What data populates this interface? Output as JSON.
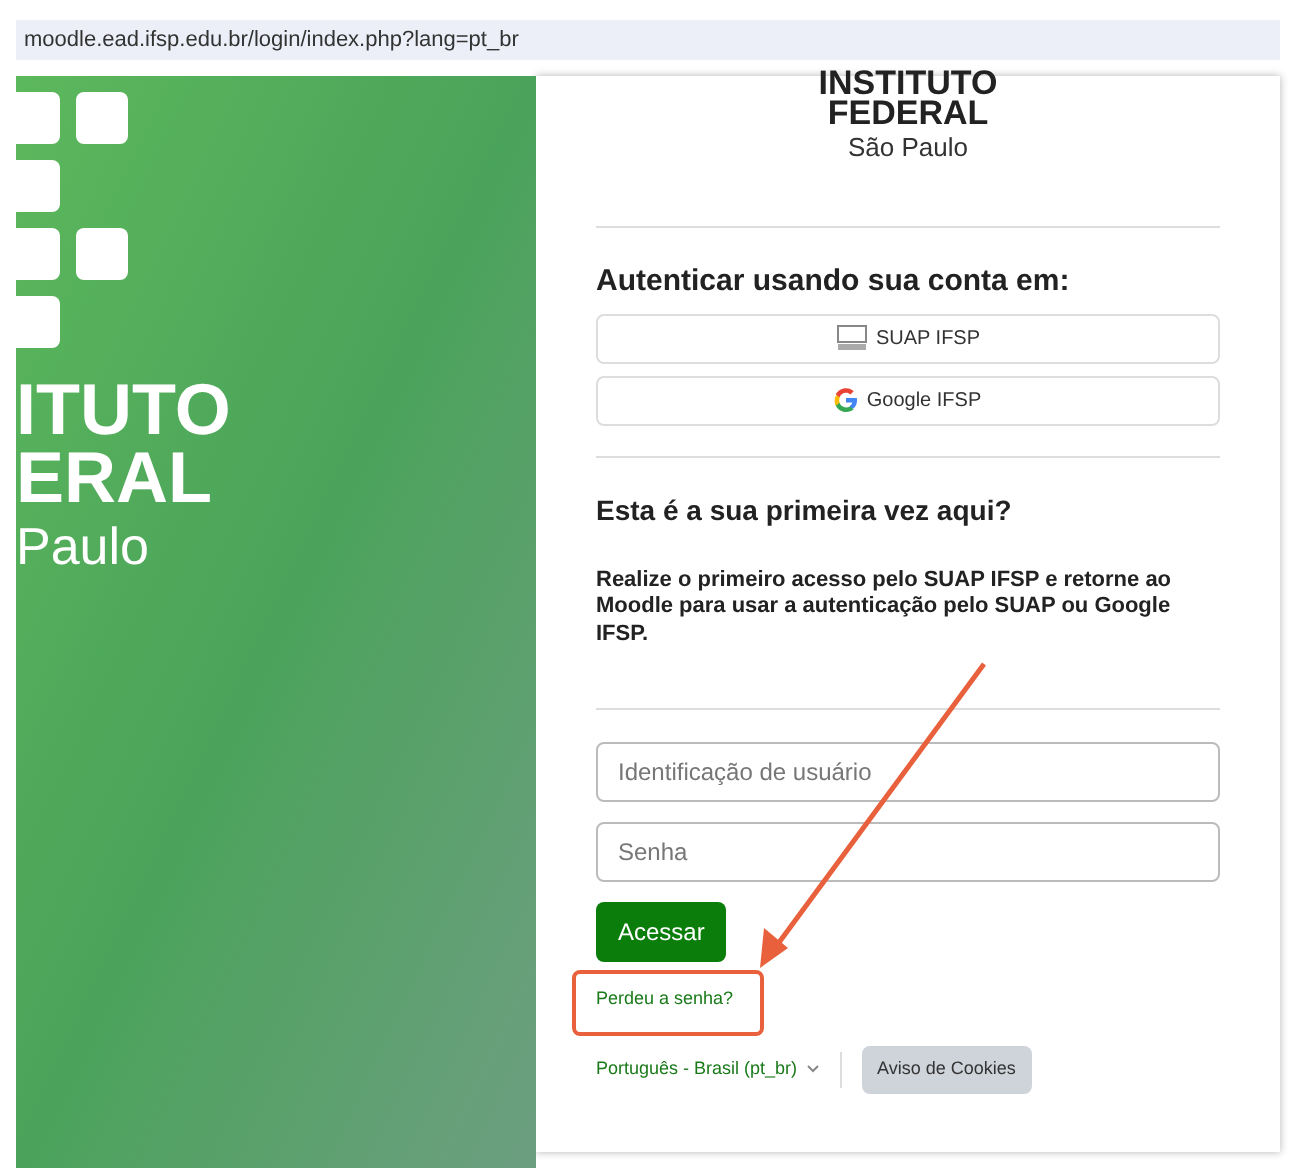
{
  "address_bar": {
    "url": "moodle.ead.ifsp.edu.br/login/index.php?lang=pt_br"
  },
  "banner": {
    "lines": [
      "ITUTO",
      "ERAL"
    ],
    "subtitle": "Paulo"
  },
  "logo": {
    "lines": [
      "INSTITUTO",
      "FEDERAL"
    ],
    "subtitle": "São Paulo"
  },
  "auth": {
    "heading": "Autenticar usando sua conta em:",
    "providers": [
      {
        "kind": "suap",
        "label": "SUAP IFSP"
      },
      {
        "kind": "google",
        "label": "Google IFSP"
      }
    ]
  },
  "first_time": {
    "heading": "Esta é a sua primeira vez aqui?",
    "text": "Realize o primeiro acesso pelo SUAP IFSP e retorne ao Moodle para usar a autenticação pelo SUAP ou Google IFSP."
  },
  "login": {
    "username": {
      "placeholder": "Identificação de usuário"
    },
    "password": {
      "placeholder": "Senha"
    },
    "submit": "Acessar",
    "forgot": "Perdeu a senha?"
  },
  "footer": {
    "language": "Português - Brasil (pt_br)",
    "cookies": "Aviso de Cookies"
  }
}
